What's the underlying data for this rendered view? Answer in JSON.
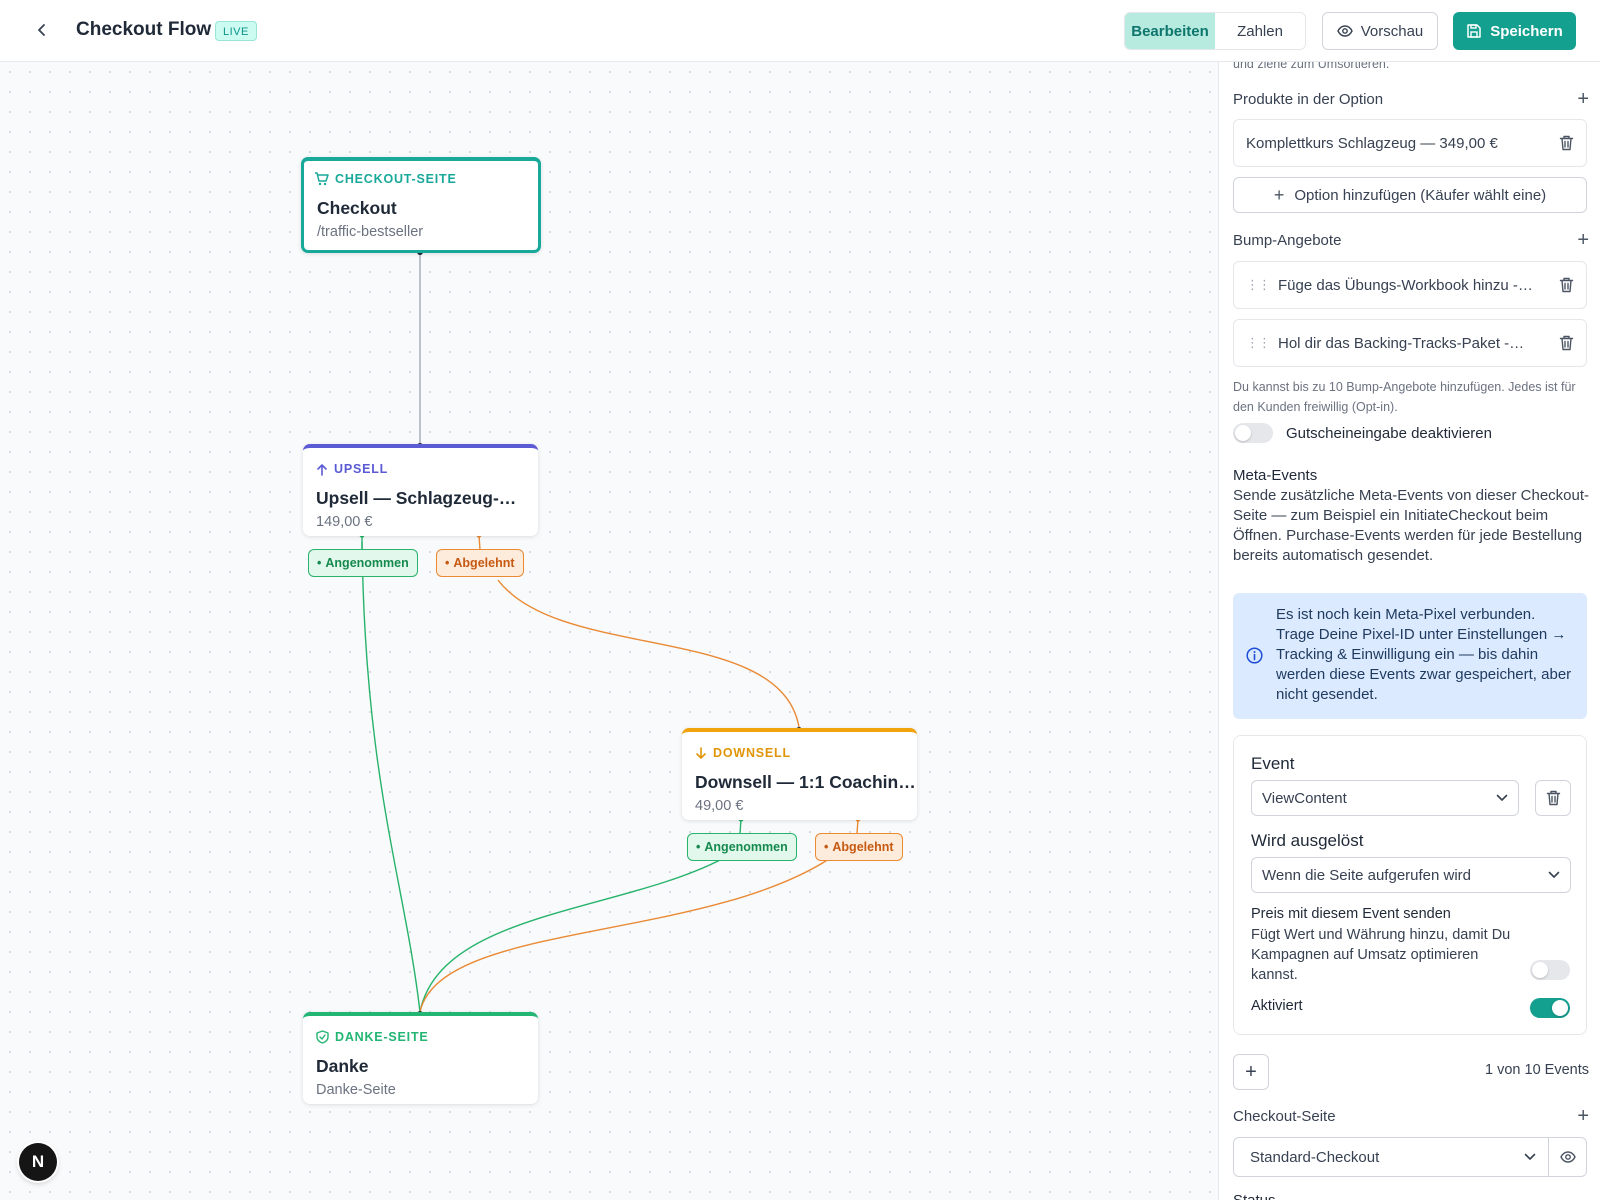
{
  "header": {
    "title": "Checkout Flow",
    "live_badge": "LIVE",
    "mode_edit": "Bearbeiten",
    "mode_numbers": "Zahlen",
    "preview": "Vorschau",
    "save": "Speichern"
  },
  "colors": {
    "accent": "#14a08f",
    "upsell": "#5b5bd6",
    "downsell": "#f0a30a",
    "thanks": "#22b573",
    "accept": "#27b36b",
    "reject": "#ea8a35"
  },
  "flow": {
    "nodes": [
      {
        "key": "checkout",
        "type_label": "CHECKOUT-SEITE",
        "title": "Checkout",
        "subtitle": "/traffic-bestseller",
        "icon": "cart-icon"
      },
      {
        "key": "upsell",
        "type_label": "UPSELL",
        "title": "Upsell — Schlagzeug-…",
        "subtitle": "149,00 €",
        "icon": "arrow-up-icon"
      },
      {
        "key": "downsell",
        "type_label": "DOWNSELL",
        "title": "Downsell — 1:1 Coachin…",
        "subtitle": "49,00 €",
        "icon": "arrow-down-icon"
      },
      {
        "key": "thanks",
        "type_label": "DANKE-SEITE",
        "title": "Danke",
        "subtitle": "Danke-Seite",
        "icon": "shield-check-icon"
      }
    ],
    "edges": [
      {
        "from": "checkout",
        "to": "upsell",
        "label": ""
      },
      {
        "from": "upsell",
        "to": "thanks",
        "label": "Angenommen"
      },
      {
        "from": "upsell",
        "to": "downsell",
        "label": "Abgelehnt"
      },
      {
        "from": "downsell",
        "to": "thanks",
        "label": "Angenommen"
      },
      {
        "from": "downsell",
        "to": "thanks",
        "label": "Abgelehnt"
      }
    ],
    "avatar_letter": "N"
  },
  "panel": {
    "cut_hint": "und ziehe zum Umsortieren.",
    "products_title": "Produkte in der Option",
    "products": [
      "Komplettkurs Schlagzeug — 349,00 €"
    ],
    "add_option": "Option hinzufügen (Käufer wählt eine)",
    "bumps_title": "Bump-Angebote",
    "bumps": [
      "Füge das Übungs-Workbook hinzu -…",
      "Hol dir das Backing-Tracks-Paket -…"
    ],
    "bumps_hint": "Du kannst bis zu 10 Bump-Angebote hinzufügen. Jedes ist für den Kunden freiwillig (Opt-in).",
    "coupon_label": "Gutscheineingabe deaktivieren",
    "coupon_enabled": false,
    "meta_title": "Meta-Events",
    "meta_desc": "Sende zusätzliche Meta-Events von dieser Checkout-Seite — zum Beispiel ein InitiateCheckout beim Öffnen. Purchase-Events werden für jede Bestellung bereits automatisch gesendet.",
    "info_text": "Es ist noch kein Meta-Pixel verbunden. Trage Deine Pixel-ID unter Einstellungen → Tracking & Einwilligung ein — bis dahin werden diese Events zwar gespeichert, aber nicht gesendet.",
    "event": {
      "event_label": "Event",
      "event_value": "ViewContent",
      "trigger_label": "Wird ausgelöst",
      "trigger_value": "Wenn die Seite aufgerufen wird",
      "price_title": "Preis mit diesem Event senden",
      "price_desc": "Fügt Wert und Währung hinzu, damit Du Kampagnen auf Umsatz optimieren kannst.",
      "price_enabled": false,
      "active_label": "Aktiviert",
      "active_enabled": true
    },
    "event_count": "1 von 10 Events",
    "checkout_page_title": "Checkout-Seite",
    "checkout_page_value": "Standard-Checkout",
    "status_cut": "Status"
  }
}
